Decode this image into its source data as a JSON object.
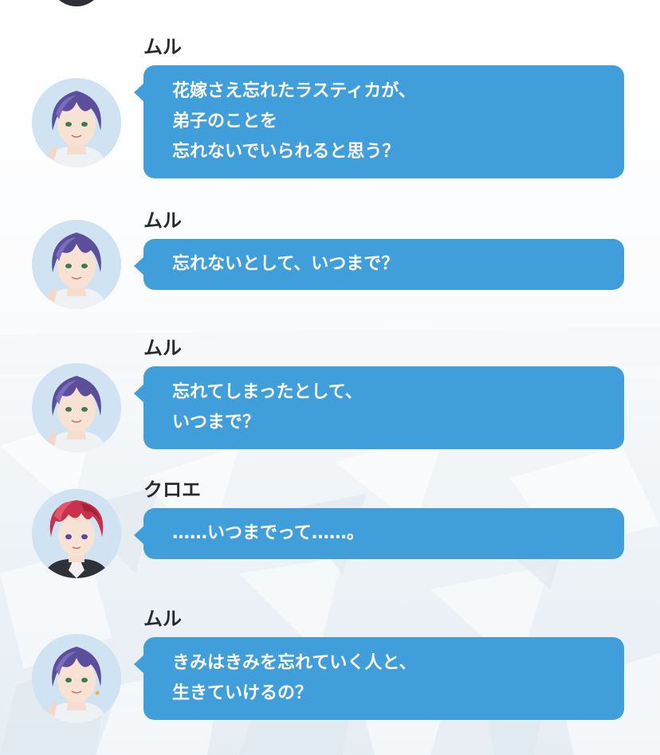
{
  "messages": [
    {
      "speaker": "ムル",
      "lines": [
        "花嫁さえ忘れたラスティカが、",
        "弟子のことを",
        "忘れないでいられると思う？"
      ]
    },
    {
      "speaker": "ムル",
      "lines": [
        "忘れないとして、いつまで？"
      ]
    },
    {
      "speaker": "ムル",
      "lines": [
        "忘れてしまったとして、",
        "いつまで？"
      ]
    },
    {
      "speaker": "クロエ",
      "lines": [
        "……いつまでって……。"
      ]
    },
    {
      "speaker": "ムル",
      "lines": [
        "きみはきみを忘れていく人と、",
        "生きていけるの？"
      ]
    }
  ],
  "colors": {
    "bubble": "#409fdb",
    "bubble_text": "#ffffff",
    "speaker_text": "#2a2a2a",
    "murr_hair": "#5b4e9a",
    "chloe_hair": "#c8324a"
  },
  "icons": {
    "murr_avatar": "murr-portrait-icon",
    "chloe_avatar": "chloe-portrait-icon"
  }
}
